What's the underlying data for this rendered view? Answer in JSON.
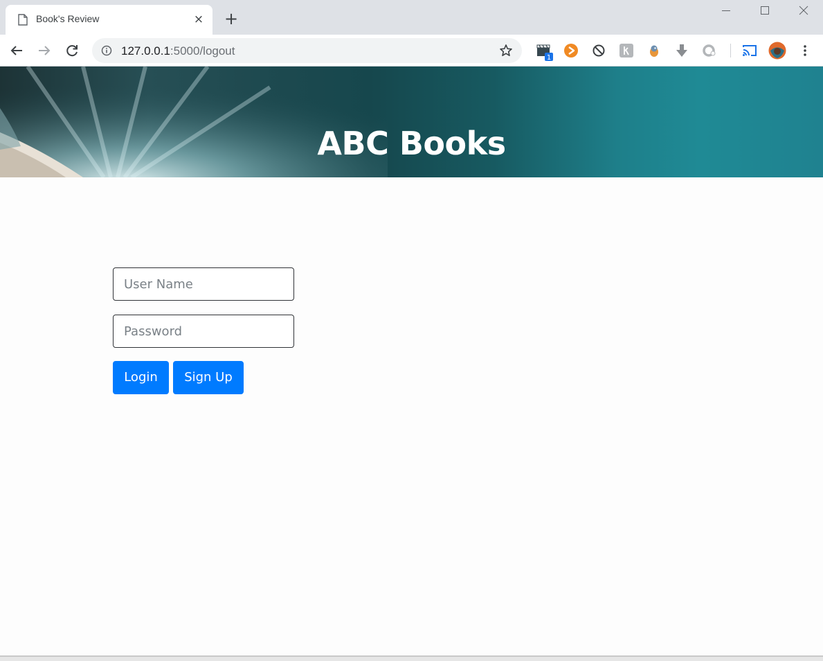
{
  "browser": {
    "tab_title": "Book's Review",
    "tab_close": "×",
    "new_tab": "+",
    "url_host": "127.0.0.1",
    "url_rest": ":5000/logout",
    "extension_badge": "1",
    "icons": [
      "page-icon",
      "close-icon",
      "plus-icon",
      "back-icon",
      "forward-icon",
      "reload-icon",
      "info-icon",
      "star-icon",
      "clapper-extension-icon",
      "play-extension-icon",
      "block-extension-icon",
      "k-extension-icon",
      "bird-extension-icon",
      "download-extension-icon",
      "ring-extension-icon",
      "cast-icon",
      "profile-avatar",
      "menu-icon"
    ]
  },
  "header": {
    "title": "ABC Books"
  },
  "login_form": {
    "username_placeholder": "User Name",
    "password_placeholder": "Password",
    "login_label": "Login",
    "signup_label": "Sign Up"
  },
  "colors": {
    "primary_button": "#007bff",
    "banner_teal": "#1f8a95"
  }
}
